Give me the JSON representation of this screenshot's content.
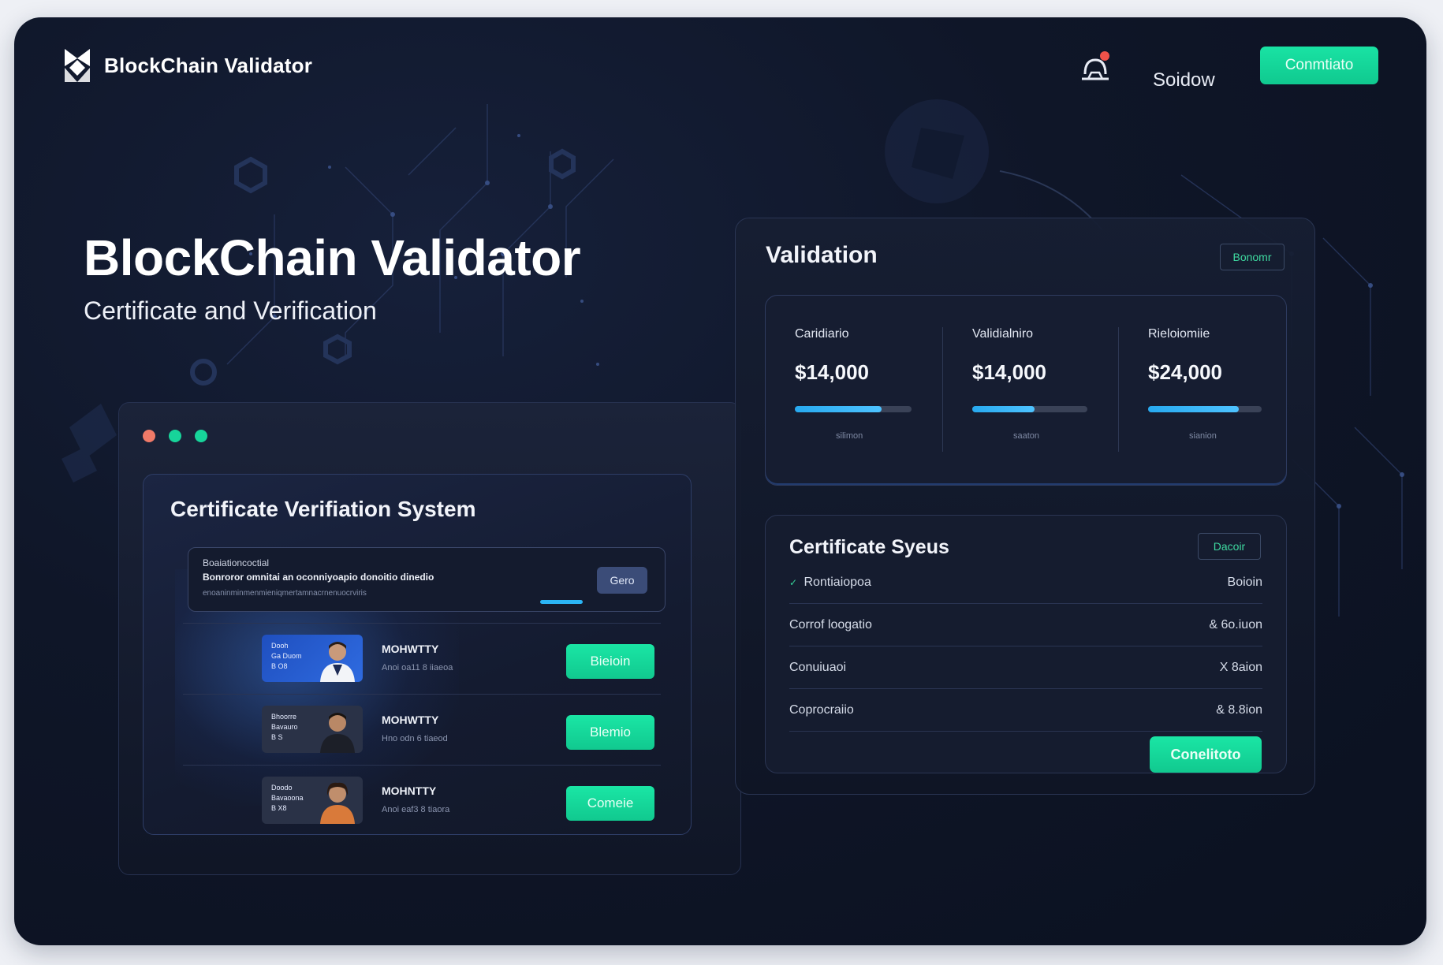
{
  "header": {
    "logo_text": "BlockChain Validator",
    "nav_link": "Soidow",
    "cta_label": "Conmtiato"
  },
  "hero": {
    "title": "BlockChain Validator",
    "subtitle": "Certificate and Verification"
  },
  "verification_system": {
    "title": "Certificate Verifiation System",
    "search": {
      "line1": "Boaiationcoctial",
      "line2": "Bonroror omnitai an oconniyoapio donoitio dinedio",
      "line3": "enoaninminmenmieniqmertamnacrnenuocrviris",
      "button_label": "Gero"
    },
    "rows": [
      {
        "thumb_text": "Dooh\nGa Duom\nB O8",
        "title": "MOHWTTY",
        "subtitle": "Anoi oa11 8 iiaeoa",
        "button_label": "Bieioin"
      },
      {
        "thumb_text": "Bhoorre\nBavauro\nB S",
        "title": "MOHWTTY",
        "subtitle": "Hno odn 6 tiaeod",
        "button_label": "Blemio"
      },
      {
        "thumb_text": "Doodo\nBavaoona\nB X8",
        "title": "MOHNTTY",
        "subtitle": "Anoi eaf3 8 tiaora",
        "button_label": "Comeie"
      }
    ]
  },
  "validation": {
    "title": "Validation",
    "badge_label": "Bonomr",
    "stats": [
      {
        "label": "Caridiario",
        "value": "$14,000",
        "caption": "silimon",
        "progress": 0.74
      },
      {
        "label": "Validialniro",
        "value": "$14,000",
        "caption": "saaton",
        "progress": 0.54
      },
      {
        "label": "Rieloiomiie",
        "value": "$24,000",
        "caption": "sianion",
        "progress": 0.8
      }
    ]
  },
  "certificate_status": {
    "title": "Certificate Syeus",
    "badge_label": "Dacoir",
    "rows": [
      {
        "icon": "check-icon",
        "label": "Rontiaiopoa",
        "value": "Boioin"
      },
      {
        "icon": "",
        "label": "Corrof loogatio",
        "value": "& 6o.iuon"
      },
      {
        "icon": "",
        "label": "Conuiuaoi",
        "value": "X 8aion"
      },
      {
        "icon": "",
        "label": "Coprocraiio",
        "value": "& 8.8ion"
      }
    ],
    "cta_label": "Conelitoto"
  },
  "colors": {
    "accent": "#14d89a",
    "background": "#0f1628",
    "progress": "#35b6f5",
    "window_dots": [
      "#f07a68",
      "#17d49a",
      "#17d49a"
    ]
  }
}
